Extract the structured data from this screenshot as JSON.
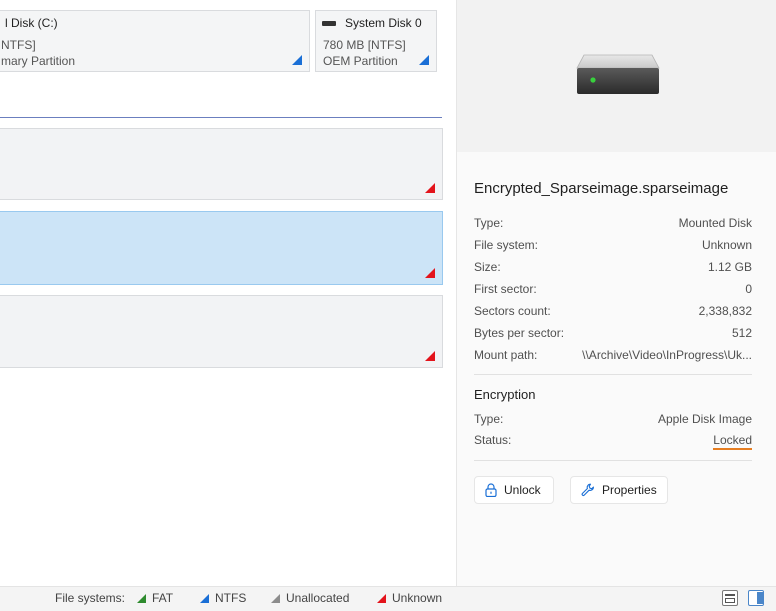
{
  "partitions": {
    "local_disk": {
      "title": "l Disk (C:)",
      "fs": "NTFS]",
      "type": "mary Partition"
    },
    "system_disk": {
      "title": "System Disk 0",
      "fs": "780 MB [NTFS]",
      "type": "OEM Partition"
    }
  },
  "details": {
    "name": "Encrypted_Sparseimage.sparseimage",
    "rows": [
      {
        "label": "Type:",
        "value": "Mounted Disk"
      },
      {
        "label": "File system:",
        "value": "Unknown"
      },
      {
        "label": "Size:",
        "value": "1.12 GB"
      },
      {
        "label": "First sector:",
        "value": "0"
      },
      {
        "label": "Sectors count:",
        "value": "2,338,832"
      },
      {
        "label": "Bytes per sector:",
        "value": "512"
      },
      {
        "label": "Mount path:",
        "value": "\\\\Archive\\Video\\InProgress\\Uk..."
      }
    ],
    "encryption": {
      "heading": "Encryption",
      "rows": [
        {
          "label": "Type:",
          "value": "Apple Disk Image"
        },
        {
          "label": "Status:",
          "value": "Locked"
        }
      ]
    }
  },
  "buttons": {
    "unlock": "Unlock",
    "properties": "Properties"
  },
  "legend": {
    "label": "File systems:",
    "items": [
      {
        "name": "FAT",
        "color": "#2e8b2e"
      },
      {
        "name": "NTFS",
        "color": "#1a6fd6"
      },
      {
        "name": "Unallocated",
        "color": "#8c8c8c"
      },
      {
        "name": "Unknown",
        "color": "#e3131b"
      }
    ]
  },
  "colors": {
    "accent": "#1a6fd6",
    "selected": "#cce4f7",
    "selected_border": "#99c9ef",
    "locked_underline": "#e67e22"
  }
}
